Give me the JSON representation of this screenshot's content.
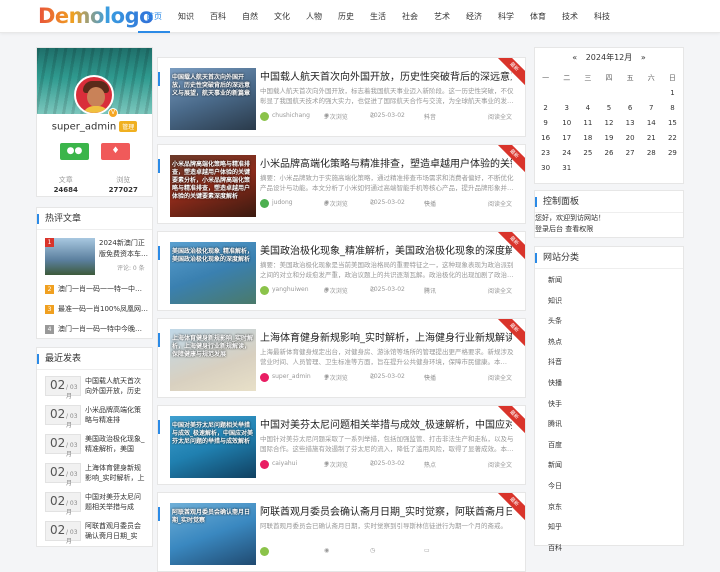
{
  "site": {
    "logo": "Demologo"
  },
  "nav": [
    "首页",
    "知识",
    "百科",
    "自然",
    "文化",
    "人物",
    "历史",
    "生活",
    "社会",
    "艺术",
    "经济",
    "科学",
    "体育",
    "技术",
    "科技"
  ],
  "profile": {
    "username": "super_admin",
    "level_badge": "管理",
    "stat_articles_label": "文章",
    "stat_articles": "24684",
    "stat_views_label": "浏览",
    "stat_views": "277027"
  },
  "hot": {
    "title": "热评文章",
    "first_title": "2024新澳门正版免费资本车…",
    "first_meta": "评论: 0 条",
    "items": [
      {
        "rank": "2",
        "title": "澳门一肖一码一一特一中…"
      },
      {
        "rank": "3",
        "title": "最准一码一肖100%凤凰网…"
      },
      {
        "rank": "4",
        "title": "澳门一肖一码一特中今晚…"
      }
    ]
  },
  "recent": {
    "title": "最近发表",
    "items": [
      {
        "day": "02",
        "mon": "/ 03月",
        "title": "中国载人航天首次向外国开放，历史"
      },
      {
        "day": "02",
        "mon": "/ 03月",
        "title": "小米品牌高端化策略与精准排"
      },
      {
        "day": "02",
        "mon": "/ 03月",
        "title": "美国政治极化现象_精准解析，美国"
      },
      {
        "day": "02",
        "mon": "/ 03月",
        "title": "上海体育健身新规影响_实时解析，上"
      },
      {
        "day": "02",
        "mon": "/ 03月",
        "title": "中国对美芬太尼问题相关举措与成"
      },
      {
        "day": "02",
        "mon": "/ 03月",
        "title": "阿联酋观月委员会确认斋月日期_实"
      }
    ]
  },
  "articles": [
    {
      "title": "中国载人航天首次向外国开放，历史性突破背后的深远意义与…",
      "excerpt": "中国载人航天首次向外国开放，标志着我国航天事业迈入新阶段。这一历史性突破，不仅彰显了我国航天技术的强大实力，也促进了国际航天合作与交流，为全球航天事业的发…",
      "img_text": "中国载人航天首次向外国开放，历史性突破背后的深远意义与展望，航天事业的新篇章",
      "author": "chushichang",
      "views": "5 次浏览",
      "date": "2025-03-02",
      "tag": "抖音",
      "more": "阅读全文",
      "ribbon": "最新"
    },
    {
      "title": "小米品牌高端化策略与精准排查，塑造卓越用户体验的关键要…",
      "excerpt": "摘要：小米品牌致力于实施高端化策略，通过精准排查市场需求和消费者偏好，不断优化产品设计与功能。本文分析了小米如何通过高端智能手机等核心产品，提升品牌形象并…",
      "img_text": "小米品牌高端化策略与精准排查，塑造卓越用户体验的关键要素分析，小米品牌高端化策略与精准排查，塑造卓越用户体验的关键要素深度解析",
      "author": "judong",
      "views": "6 次浏览",
      "date": "2025-03-02",
      "tag": "快播",
      "more": "阅读全文",
      "ribbon": "最新"
    },
    {
      "title": "美国政治极化现象_精准解析，美国政治极化现象的深度解析",
      "excerpt": "摘要：美国政治极化现象是当前美国政治格局的重要特征之一，这种现象表现为政治派别之间的对立和分歧愈发严重，政治议题上的共识逐渐瓦解。政治极化的出现加剧了政治…",
      "img_text": "美国政治极化现象_精准解析，美国政治极化现象的深度解析",
      "author": "yanghuiwen",
      "views": "0 次浏览",
      "date": "2025-03-02",
      "tag": "腾讯",
      "more": "阅读全文",
      "ribbon": "最新"
    },
    {
      "title": "上海体育健身新规影响_实时解析，上海健身行业新规解读，…",
      "excerpt": "上海最新体育健身规定出台，对健身房、游泳馆等场所的管理提出更严格要求。新规涉及营业时间、人员管理、卫生标准等方面，旨在提升公共健身环境，保障市民健康。本…",
      "img_text": "上海体育健身新规影响_实时解析，上海健身行业新规解读，保障健康与规范发展",
      "author": "super_admin",
      "views": "1 次浏览",
      "date": "2025-03-02",
      "tag": "快播",
      "more": "阅读全文",
      "ribbon": "最新"
    },
    {
      "title": "中国对美芬太尼问题相关举措与成效_极速解析，中国应对美…",
      "excerpt": "中国针对美芬太尼问题采取了一系列举措，包括加强监管、打击非法生产和走私，以及与国际合作。这些措施有效遏制了芬太尼的流入，降低了滥用风险，取得了显著成效。本…",
      "img_text": "中国对美芬太尼问题相关举措与成效_极速解析，中国应对美芬太尼问题的举措与成效解析",
      "author": "caiyahui",
      "views": "3 次浏览",
      "date": "2025-03-02",
      "tag": "热点",
      "more": "阅读全文",
      "ribbon": "最新"
    },
    {
      "title": "阿联酋观月委员会确认斋月日期_实时觉察，阿联酋斋月日期…",
      "excerpt": "阿联酋观月委员会已确认斋月日期，实时觉察到引导斯林信徒进行为期一个月的斋戒。",
      "img_text": "阿联酋观月委员会确认斋月日期_实时觉察",
      "author": "",
      "views": "",
      "date": "",
      "tag": "",
      "more": "",
      "ribbon": "最新"
    }
  ],
  "calendar": {
    "prev": "«",
    "month": "2024年12月",
    "next": "»",
    "weekdays": [
      "一",
      "二",
      "三",
      "四",
      "五",
      "六",
      "日"
    ],
    "weeks": [
      [
        "",
        "",
        "",
        "",
        "",
        "",
        "1"
      ],
      [
        "2",
        "3",
        "4",
        "5",
        "6",
        "7",
        "8"
      ],
      [
        "9",
        "10",
        "11",
        "12",
        "13",
        "14",
        "15"
      ],
      [
        "16",
        "17",
        "18",
        "19",
        "20",
        "21",
        "22"
      ],
      [
        "23",
        "24",
        "25",
        "26",
        "27",
        "28",
        "29"
      ],
      [
        "30",
        "31",
        "",
        "",
        "",
        "",
        ""
      ]
    ]
  },
  "control": {
    "title": "控制面板",
    "greeting": "您好，欢迎到访网站！",
    "login": "登录后台",
    "view_perm": "查看权限"
  },
  "categories": {
    "title": "网站分类",
    "items": [
      "新闻",
      "知识",
      "头条",
      "热点",
      "抖音",
      "快播",
      "快手",
      "腾讯",
      "百度",
      "新闻",
      "今日",
      "京东",
      "知乎",
      "百科"
    ]
  }
}
